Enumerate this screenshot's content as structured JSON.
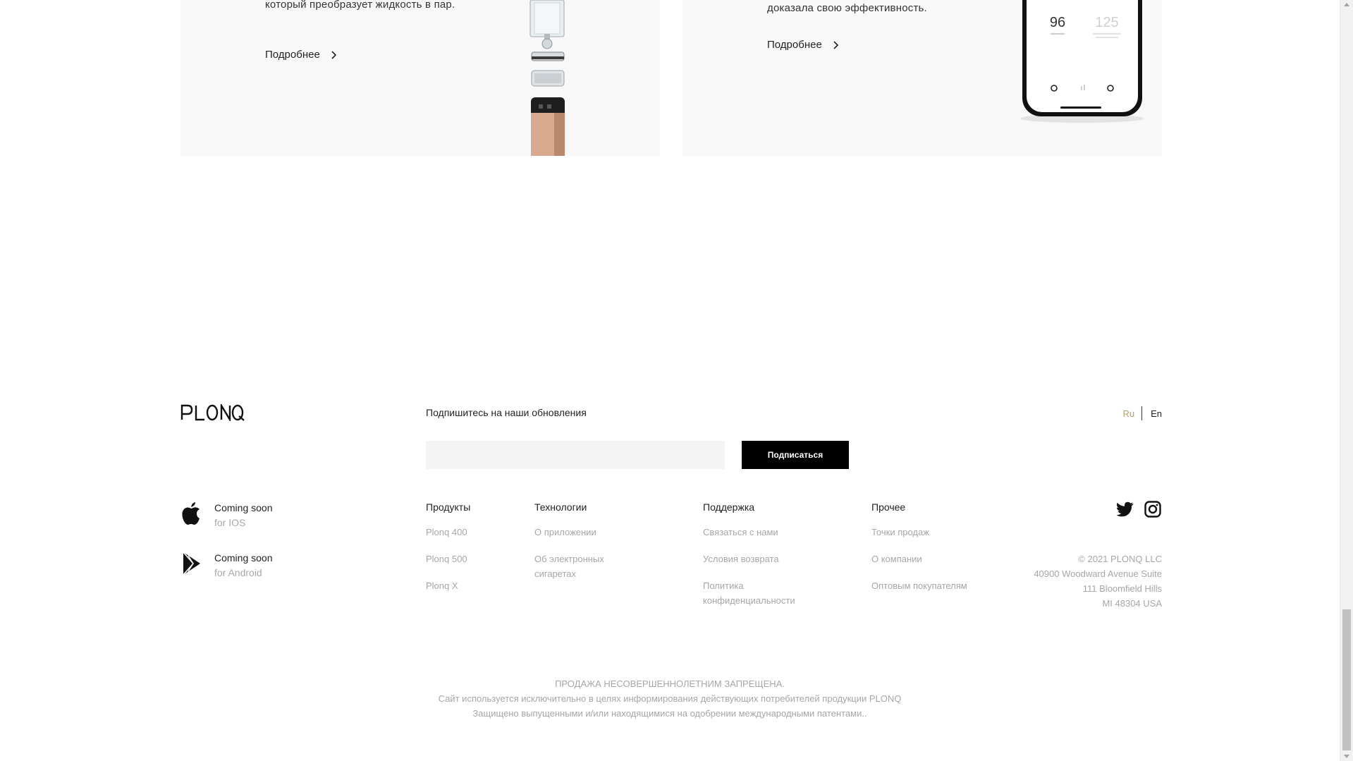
{
  "cards": {
    "left": {
      "text": "который преобразует жидкость в пар.",
      "more_label": "Подробнее"
    },
    "right": {
      "text": "доказала свою эффективность.",
      "more_label": "Подробнее",
      "phone_screen": {
        "value_left": "96",
        "value_right": "125"
      }
    }
  },
  "footer": {
    "brand": "PLONQ",
    "subscribe": {
      "title": "Подпишитесь на наши обновления",
      "email_placeholder": "",
      "button_label": "Подписаться"
    },
    "languages": {
      "active": "Ru",
      "other": "En",
      "active_color": "#b3a169"
    },
    "apps": [
      {
        "line1": "Coming soon",
        "line2": "for IOS",
        "icon": "apple-icon"
      },
      {
        "line1": "Coming soon",
        "line2": "for Android",
        "icon": "google-play-icon"
      }
    ],
    "columns": {
      "products": {
        "title": "Продукты",
        "items": [
          "Plonq 400",
          "Plonq 500",
          "Plonq X"
        ]
      },
      "technologies": {
        "title": "Технологии",
        "items": [
          "О приложении",
          "Об электронных сигаретах"
        ]
      },
      "support": {
        "title": "Поддержка",
        "items": [
          "Связаться с нами",
          "Условия возврата",
          "Политика конфиденциальности"
        ]
      },
      "other": {
        "title": "Прочее",
        "items": [
          "Точки продаж",
          "О компании",
          "Оптовым покупателям"
        ]
      }
    },
    "social": [
      "twitter-icon",
      "instagram-icon"
    ],
    "address": [
      "© 2021 PLONQ LLC",
      "40900 Woodward Avenue Suite",
      "111 Bloomfield Hills",
      "MI 48304 USA"
    ],
    "legal": [
      "ПРОДАЖА НЕСОВЕРШЕННОЛЕТНИМ ЗАПРЕЩЕНА.",
      "Сайт используется исключительно в целях информирования действующих потребителей продукции PLONQ",
      "Защищено выпущенными и/или находящимися на одобрении международными патентами.."
    ]
  },
  "colors": {
    "button_bg": "#000000",
    "muted_text": "#a6a6a6",
    "card_bg": "#f8f8f8"
  }
}
